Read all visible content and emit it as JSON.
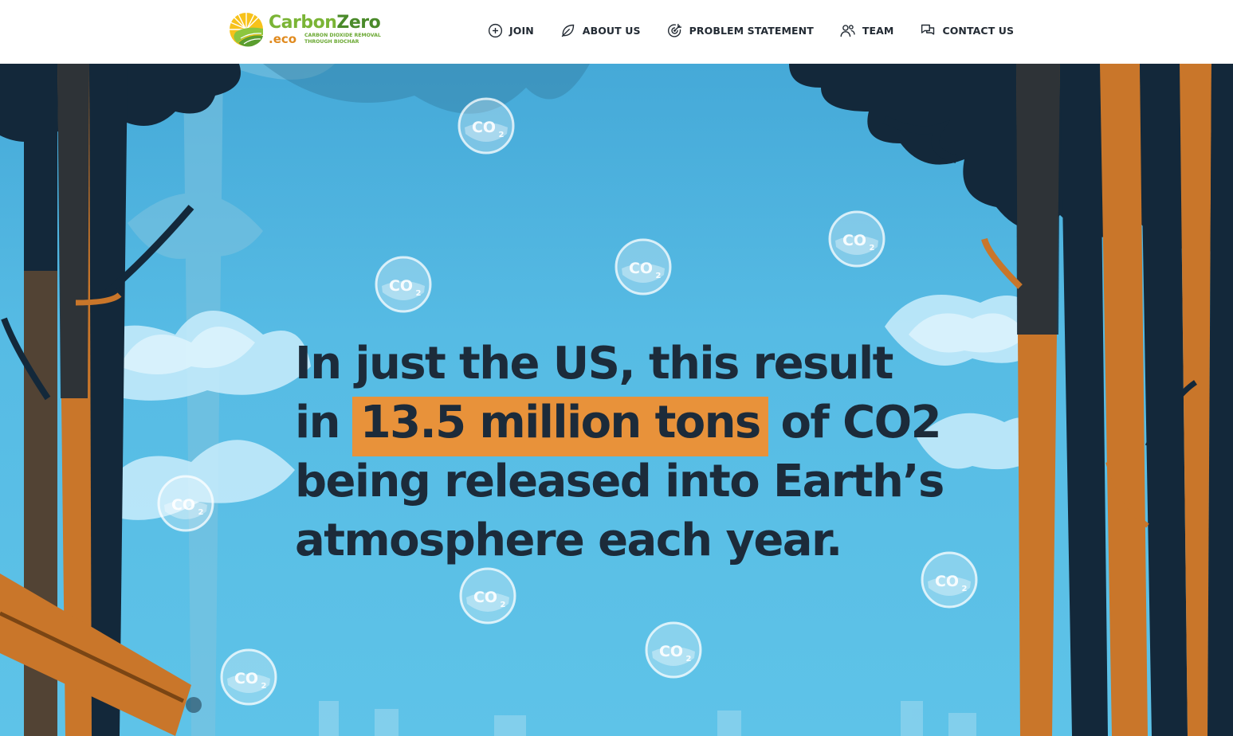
{
  "brand": {
    "name_part1": "Carbon",
    "name_part2": "Zero",
    "domain": ".eco",
    "tagline": "CARBON DIOXIDE REMOVAL THROUGH BIOCHAR"
  },
  "nav": {
    "items": [
      {
        "label": "JOIN",
        "icon": "plus-circle-icon"
      },
      {
        "label": "ABOUT US",
        "icon": "leaf-icon"
      },
      {
        "label": "PROBLEM STATEMENT",
        "icon": "target-icon"
      },
      {
        "label": "TEAM",
        "icon": "users-icon"
      },
      {
        "label": "CONTACT US",
        "icon": "chat-bubbles-icon"
      }
    ]
  },
  "hero": {
    "line1": "In just the US, this result",
    "line2_start": "in ",
    "line2_highlight": "13.5 million tons",
    "line2_end": " of CO2",
    "line3": "being released into Earth’s",
    "line4": "atmosphere each year.",
    "bubble_label": "CO2",
    "bubble_sub": "2"
  },
  "colors": {
    "sky_top": "#45a9d8",
    "sky_bottom": "#5ec3e8",
    "highlight": "#e8923a",
    "headline_text": "#1c2b3a",
    "tree_dark": "#13283a",
    "tree_orange": "#c9762a",
    "brand_green": "#7ab435",
    "brand_orange": "#e08a1e"
  }
}
